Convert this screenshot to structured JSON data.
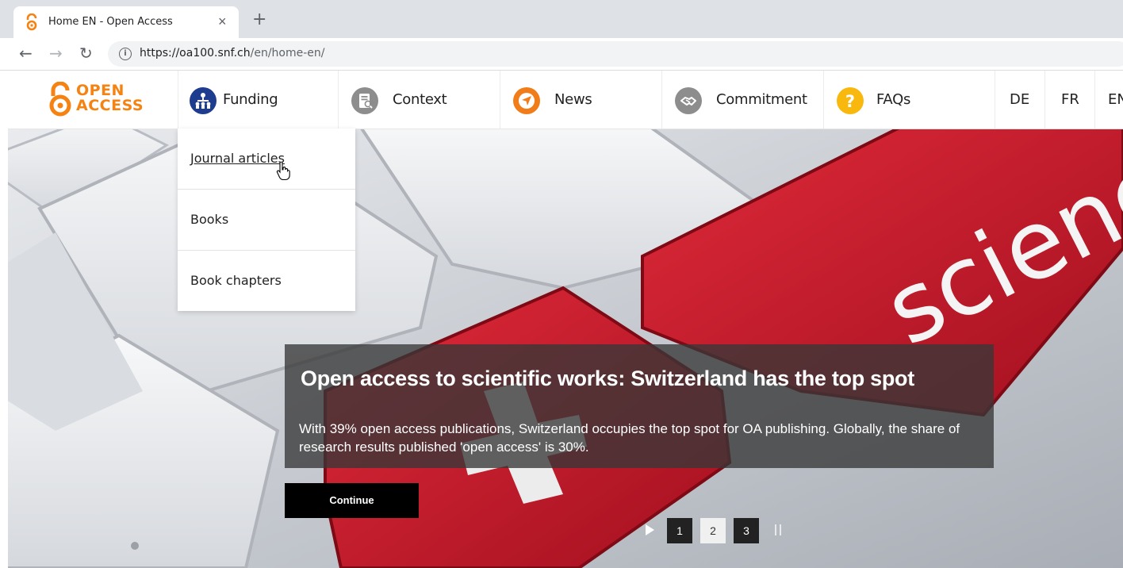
{
  "browser": {
    "tab_title": "Home EN - Open Access",
    "tab_close": "×",
    "new_tab": "+",
    "url_host": "https://oa100.snf.ch",
    "url_path": "/en/home-en/"
  },
  "site": {
    "logo_line1": "OPEN",
    "logo_line2": "ACCESS",
    "nav": [
      {
        "label": "Funding",
        "icon": "funding-icon",
        "color": "#1e3d8f"
      },
      {
        "label": "Context",
        "icon": "context-icon",
        "color": "#8d8d8d"
      },
      {
        "label": "News",
        "icon": "news-icon",
        "color": "#f07d1a"
      },
      {
        "label": "Commitment",
        "icon": "commitment-icon",
        "color": "#8d8d8d"
      },
      {
        "label": "FAQs",
        "icon": "faqs-icon",
        "color": "#f9b80e"
      }
    ],
    "languages": [
      "DE",
      "FR",
      "EN"
    ],
    "dropdown": [
      "Journal articles",
      "Books",
      "Book chapters"
    ]
  },
  "hero": {
    "title": "Open access to scientific works: Switzerland has the top spot",
    "text": "With 39% open access publications, Switzerland occupies the top spot for OA publishing. Globally, the share of research results published 'open access' is 30%.",
    "button": "Continue",
    "keyboard_word": "scienc",
    "pages": [
      "1",
      "2",
      "3"
    ],
    "active_page": "2"
  }
}
